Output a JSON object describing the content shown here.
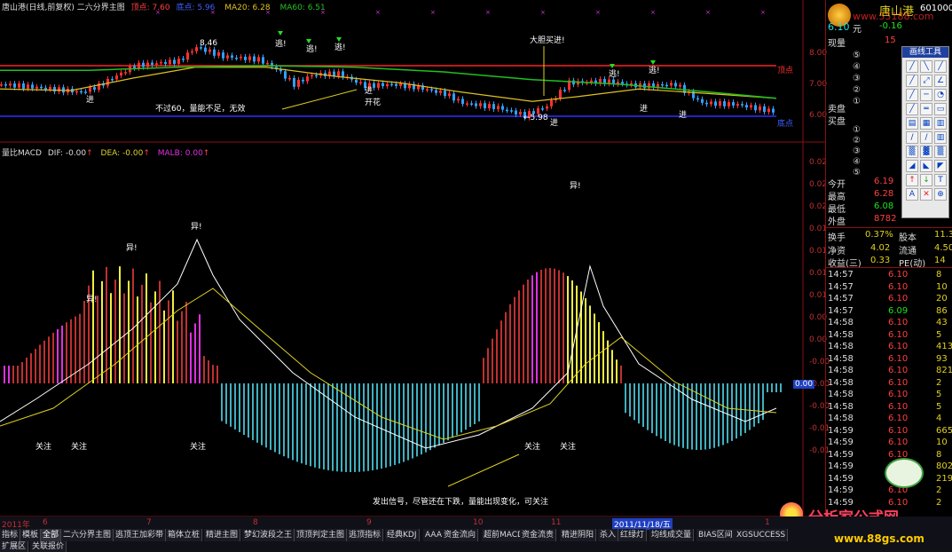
{
  "header": {
    "title": "唐山港(日线,前复权) 二六分界主图",
    "top_label": "顶点: 7.60",
    "bottom_label": "底点: 5.96",
    "ma20": "MA20: 6.28",
    "ma60": "MA60: 6.51"
  },
  "price_axis": [
    "8.00",
    "7.00",
    "6.00"
  ],
  "price_markers": {
    "top": "顶点",
    "bottom": "底点"
  },
  "price_annotations": [
    {
      "text": "8.46"
    },
    {
      "text": "←5.98"
    },
    {
      "text": "进"
    },
    {
      "text": "进"
    },
    {
      "text": "开花"
    },
    {
      "text": "进"
    },
    {
      "text": "进"
    },
    {
      "text": "进"
    },
    {
      "text": "逃!"
    },
    {
      "text": "逃!"
    },
    {
      "text": "逃!"
    },
    {
      "text": "逃!"
    },
    {
      "text": "逃!"
    },
    {
      "text": "大胆买进!"
    },
    {
      "text": "不过60，量能不足，无效"
    }
  ],
  "macd_header": {
    "name": "量比MACD",
    "dif": "DIF: -0.00",
    "dea": "DEA: -0.00",
    "malb": "MALB: 0.00"
  },
  "macd_axis": [
    "0.02",
    "0.02",
    "0.02",
    "0.01",
    "0.01",
    "0.01",
    "0.01",
    "0.00",
    "0.00",
    "-0.00",
    "-0.00",
    "-0.00",
    "-0.01",
    "-0.01"
  ],
  "macd_current": "0.00",
  "macd_annotations": [
    {
      "text": "异!"
    },
    {
      "text": "异!"
    },
    {
      "text": "异!"
    },
    {
      "text": "异!"
    },
    {
      "text": "关注"
    },
    {
      "text": "关注"
    },
    {
      "text": "关注"
    },
    {
      "text": "关注"
    },
    {
      "text": "关注"
    },
    {
      "text": "发出信号，尽管还在下跌，量能出现变化，可关注"
    }
  ],
  "x_axis": [
    "2011年",
    "6",
    "7",
    "8",
    "9",
    "10",
    "11",
    "2011/11/18/五",
    "1"
  ],
  "right_panel": {
    "stock_name": "唐山港",
    "stock_code": "601000",
    "price": "6.10",
    "price_unit": "元",
    "change": "-0.16",
    "now_vol_label": "现量",
    "now_vol": "15",
    "sell_label": "卖盘",
    "buy_label": "买盘",
    "levels": [
      "⑤",
      "④",
      "③",
      "②",
      "①"
    ],
    "open_label": "今开",
    "open": "6.19",
    "high_label": "最高",
    "high": "6.28",
    "low_label": "最低",
    "low": "6.08",
    "outer_label": "外盘",
    "outer": "8782",
    "turnover_label": "换手",
    "turnover": "0.37%",
    "shares_label": "股本",
    "shares": "11.3",
    "nav_label": "净资",
    "nav": "4.02",
    "float_label": "流通",
    "float": "4.50",
    "eps_label": "收益(三)",
    "eps": "0.33",
    "pe_label": "PE(动)",
    "pe": "14",
    "ticks": [
      {
        "t": "14:57",
        "p": "6.10",
        "v": "8"
      },
      {
        "t": "14:57",
        "p": "6.10",
        "v": "10"
      },
      {
        "t": "14:57",
        "p": "6.10",
        "v": "20"
      },
      {
        "t": "14:57",
        "p": "6.09",
        "v": "86"
      },
      {
        "t": "14:58",
        "p": "6.10",
        "v": "43"
      },
      {
        "t": "14:58",
        "p": "6.10",
        "v": "5"
      },
      {
        "t": "14:58",
        "p": "6.10",
        "v": "413"
      },
      {
        "t": "14:58",
        "p": "6.10",
        "v": "93"
      },
      {
        "t": "14:58",
        "p": "6.10",
        "v": "821"
      },
      {
        "t": "14:58",
        "p": "6.10",
        "v": "2"
      },
      {
        "t": "14:58",
        "p": "6.10",
        "v": "5"
      },
      {
        "t": "14:58",
        "p": "6.10",
        "v": "5"
      },
      {
        "t": "14:58",
        "p": "6.10",
        "v": "4"
      },
      {
        "t": "14:59",
        "p": "6.10",
        "v": "665"
      },
      {
        "t": "14:59",
        "p": "6.10",
        "v": "10"
      },
      {
        "t": "14:59",
        "p": "6.10",
        "v": "8"
      },
      {
        "t": "14:59",
        "p": "6.10",
        "v": "802"
      },
      {
        "t": "14:59",
        "p": "6.10",
        "v": "219"
      },
      {
        "t": "14:59",
        "p": "6.10",
        "v": "2"
      },
      {
        "t": "14:59",
        "p": "6.10",
        "v": "2"
      }
    ]
  },
  "watermark_top": "www.55188.com",
  "watermark_bottom_title": "分析家公式网",
  "watermark_bottom_url": "www.88gs.com",
  "toolbar": {
    "title": "画线工具"
  },
  "tabs_row1": [
    "指标",
    "模板",
    "全部",
    "二六分界主图",
    "逃顶王加彩带",
    "箱体立桩",
    "精进主图",
    "梦幻波段之王",
    "顶顶判定主图",
    "逃顶指标",
    "经典KDJ",
    "AAA",
    "资金流向",
    "超前MACD",
    "资金流责",
    "精进阴阳",
    "杀入",
    "红绿灯",
    "均线成交量",
    "BIAS区间",
    "XGSUCCESS"
  ],
  "tabs_row2": [
    "扩展区",
    "关联报价"
  ],
  "colors": {
    "ma20": "#e0c020",
    "ma60": "#20c020",
    "up": "#ff3030",
    "down": "#30a0ff",
    "hist_pos": "#c03030",
    "hist_yellow": "#f0f040",
    "hist_magenta": "#e030e0",
    "hist_neg": "#40b0c0"
  }
}
